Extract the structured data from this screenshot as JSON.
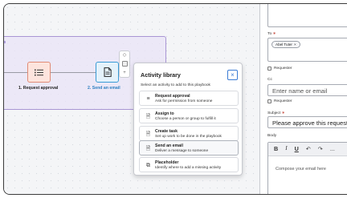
{
  "canvas": {
    "stage_label": "ps",
    "nodes": [
      {
        "caption": "1. Request approval",
        "icon": "list-icon"
      },
      {
        "caption": "2. Send an email",
        "icon": "document-icon"
      }
    ]
  },
  "mini_toolbar": {
    "icons": [
      "diamond-icon",
      "square-icon",
      "plus-icon"
    ]
  },
  "activity_library": {
    "title": "Activity library",
    "subtitle": "Select an activity to add to this playbook",
    "close_icon": "close-icon",
    "items": [
      {
        "title": "Request approval",
        "desc": "Ask for permission from someone",
        "icon": "list-icon",
        "glyph": "≡"
      },
      {
        "title": "Assign to",
        "desc": "Choose a person or group to fulfill it",
        "icon": "document-icon",
        "glyph": "🗎"
      },
      {
        "title": "Create task",
        "desc": "Set up work to be done in the playbook",
        "icon": "document-icon",
        "glyph": "🗎"
      },
      {
        "title": "Send an email",
        "desc": "Deliver a message to someone",
        "icon": "document-icon",
        "glyph": "🗎"
      },
      {
        "title": "Placeholder",
        "desc": "Identify where to add a missing activity",
        "icon": "puzzle-icon",
        "glyph": "⧉"
      }
    ],
    "selected_index": 3
  },
  "panel": {
    "to_label": "To",
    "required_mark": "∗",
    "to_chip": "Abel Tuter",
    "chip_remove": "×",
    "requester_label": "Requester",
    "cc_label": "Cc",
    "cc_placeholder": "Enter name or email",
    "subject_label": "Subject",
    "subject_value": "Please approve this request",
    "body_label": "Body",
    "toolbar": {
      "bold": "B",
      "italic": "I",
      "underline": "U",
      "undo": "↶",
      "redo": "↷",
      "more": "..."
    },
    "body_placeholder": "Compose your email here"
  },
  "colors": {
    "accent": "#3a7bd5",
    "stage_border": "#a996d4",
    "approval_node": "#fde4dd",
    "email_node": "#e4f2fb"
  }
}
